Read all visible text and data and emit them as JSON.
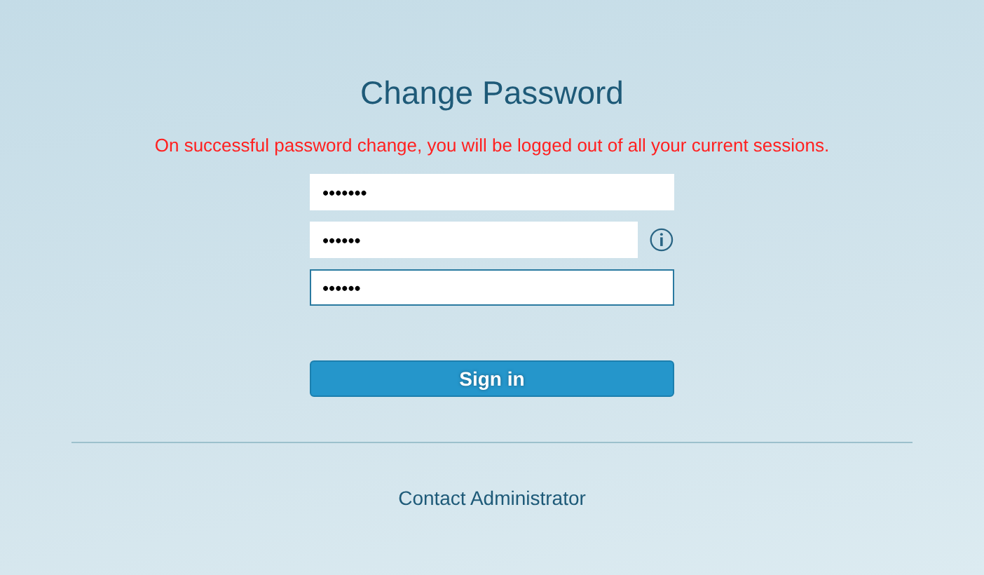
{
  "title": "Change Password",
  "notice": "On successful password change, you will be logged out of all your current sessions.",
  "fields": [
    {
      "value": "•••••••",
      "focused": false,
      "info": false
    },
    {
      "value": "••••••",
      "focused": false,
      "info": true
    },
    {
      "value": "••••••",
      "focused": true,
      "info": false
    }
  ],
  "submit_button": "Sign in",
  "footer_link": "Contact Administrator"
}
